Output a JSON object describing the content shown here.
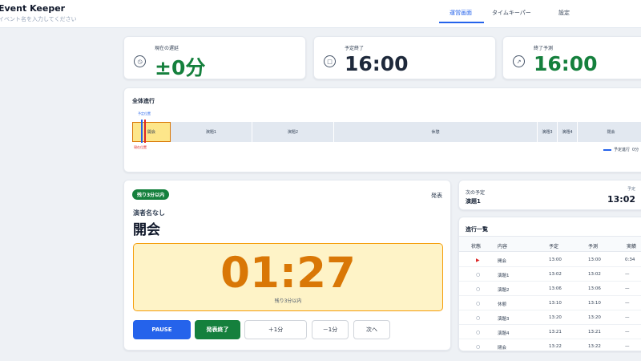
{
  "header": {
    "title": "Event Keeper",
    "subtitle": "イベント名を入力してください",
    "tabs": [
      {
        "label": "運営画面",
        "active": true
      },
      {
        "label": "タイムキーパー",
        "active": false
      },
      {
        "label": "設定",
        "active": false
      }
    ]
  },
  "stats": [
    {
      "label": "現在の遅延",
      "value": "±0分",
      "icon": "clock-icon",
      "color": "#15803d"
    },
    {
      "label": "予定終了",
      "value": "16:00",
      "icon": "stop-square-icon",
      "color": "#1e293b"
    },
    {
      "label": "終了予測",
      "value": "16:00",
      "icon": "arrow-up-right-icon",
      "color": "#15803d"
    }
  ],
  "timeline": {
    "title": "全体進行",
    "planned_marker_label": "予定位置",
    "current_marker_label": "現在位置",
    "segments": [
      "開会",
      "演題1",
      "演題2",
      "休憩",
      "演題3",
      "演題4",
      "閉会"
    ],
    "legend": {
      "label": "予定進行",
      "value": "0分"
    },
    "colors": {
      "planned": "#2563eb",
      "current": "#dc2626"
    }
  },
  "current": {
    "badge": "残り3分以内",
    "type_label": "発表",
    "presenter": "演者名なし",
    "title": "開会",
    "timer": "01:27",
    "timer_caption": "残り3分以内",
    "buttons": {
      "pause": "PAUSE",
      "finish": "発表終了",
      "plus": "＋1分",
      "minus": "－1分",
      "next": "次へ"
    }
  },
  "next": {
    "label": "次の予定",
    "title": "演題1",
    "time_label": "予定",
    "time": "13:02"
  },
  "progress_list": {
    "title": "進行一覧",
    "columns": [
      "状態",
      "内容",
      "予定",
      "予測",
      "実績"
    ],
    "rows": [
      {
        "status": "playing",
        "content": "開会",
        "planned": "13:00",
        "forecast": "13:00",
        "actual": "0:34"
      },
      {
        "status": "pending",
        "content": "演題1",
        "planned": "13:02",
        "forecast": "13:02",
        "actual": "—"
      },
      {
        "status": "pending",
        "content": "演題2",
        "planned": "13:06",
        "forecast": "13:06",
        "actual": "—"
      },
      {
        "status": "pending",
        "content": "休憩",
        "planned": "13:10",
        "forecast": "13:10",
        "actual": "—"
      },
      {
        "status": "pending",
        "content": "演題3",
        "planned": "13:20",
        "forecast": "13:20",
        "actual": "—"
      },
      {
        "status": "pending",
        "content": "演題4",
        "planned": "13:21",
        "forecast": "13:21",
        "actual": "—"
      },
      {
        "status": "pending",
        "content": "閉会",
        "planned": "13:22",
        "forecast": "13:22",
        "actual": "—"
      }
    ]
  }
}
